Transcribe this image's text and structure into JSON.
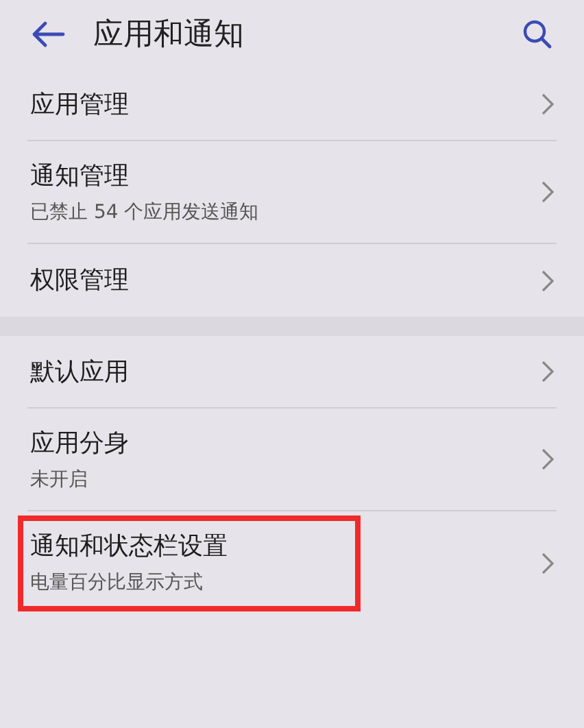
{
  "header": {
    "title": "应用和通知"
  },
  "sections": [
    {
      "items": [
        {
          "title": "应用管理",
          "highlighted": false
        },
        {
          "title": "通知管理",
          "subtitle": "已禁止 54 个应用发送通知",
          "highlighted": false
        },
        {
          "title": "权限管理",
          "highlighted": false
        }
      ]
    },
    {
      "items": [
        {
          "title": "默认应用",
          "highlighted": false
        },
        {
          "title": "应用分身",
          "subtitle": "未开启",
          "highlighted": false
        },
        {
          "title": "通知和状态栏设置",
          "subtitle": "电量百分比显示方式",
          "highlighted": true
        }
      ]
    }
  ]
}
